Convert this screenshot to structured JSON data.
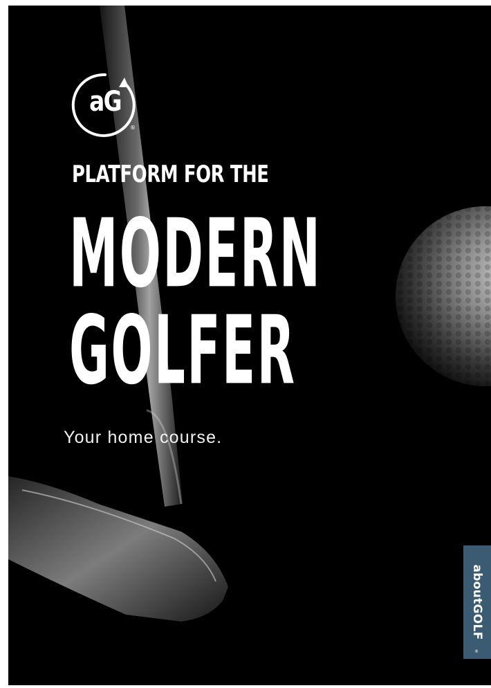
{
  "logo": {
    "text": "aG",
    "registered": "®",
    "icon": "circular-arrow-icon"
  },
  "hero": {
    "kicker": "PLATFORM FOR THE",
    "headline_line1": "MODERN",
    "headline_line2": "GOLFER",
    "tagline": "Your home course."
  },
  "brand_tab": {
    "text": "aboutGOLF",
    "registered": "®"
  },
  "colors": {
    "background": "#000000",
    "text": "#ffffff",
    "brand_tab": "#3b5b72"
  }
}
